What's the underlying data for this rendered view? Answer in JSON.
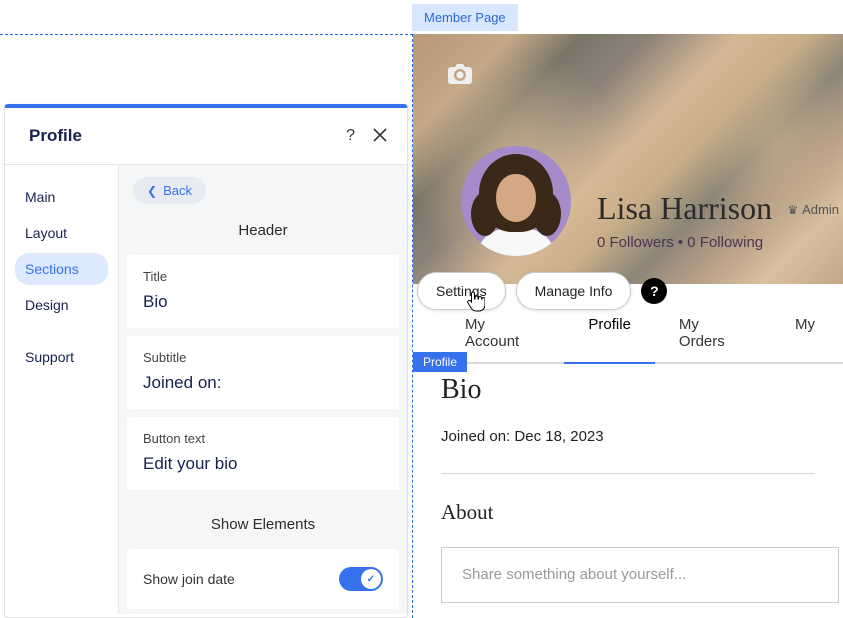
{
  "top_tag": "Member Page",
  "panel": {
    "title": "Profile",
    "sidebar": {
      "items": [
        "Main",
        "Layout",
        "Sections",
        "Design"
      ],
      "support": "Support",
      "active_index": 2
    },
    "back": "Back",
    "header_section": {
      "heading": "Header",
      "fields": [
        {
          "label": "Title",
          "value": "Bio"
        },
        {
          "label": "Subtitle",
          "value": "Joined on:"
        },
        {
          "label": "Button text",
          "value": "Edit your bio"
        }
      ],
      "show_elements": "Show Elements",
      "toggle_label": "Show join date"
    }
  },
  "preview": {
    "name": "Lisa Harrison",
    "admin": "Admin",
    "followers": "0 Followers • 0 Following",
    "actions": {
      "settings": "Settings",
      "manage": "Manage Info"
    },
    "tabs": [
      "My Account",
      "Profile",
      "My Orders",
      "My"
    ],
    "active_tab": 1,
    "profile_tag": "Profile",
    "bio_heading": "Bio",
    "joined": "Joined on: Dec 18, 2023",
    "about_heading": "About",
    "about_placeholder": "Share something about yourself..."
  }
}
